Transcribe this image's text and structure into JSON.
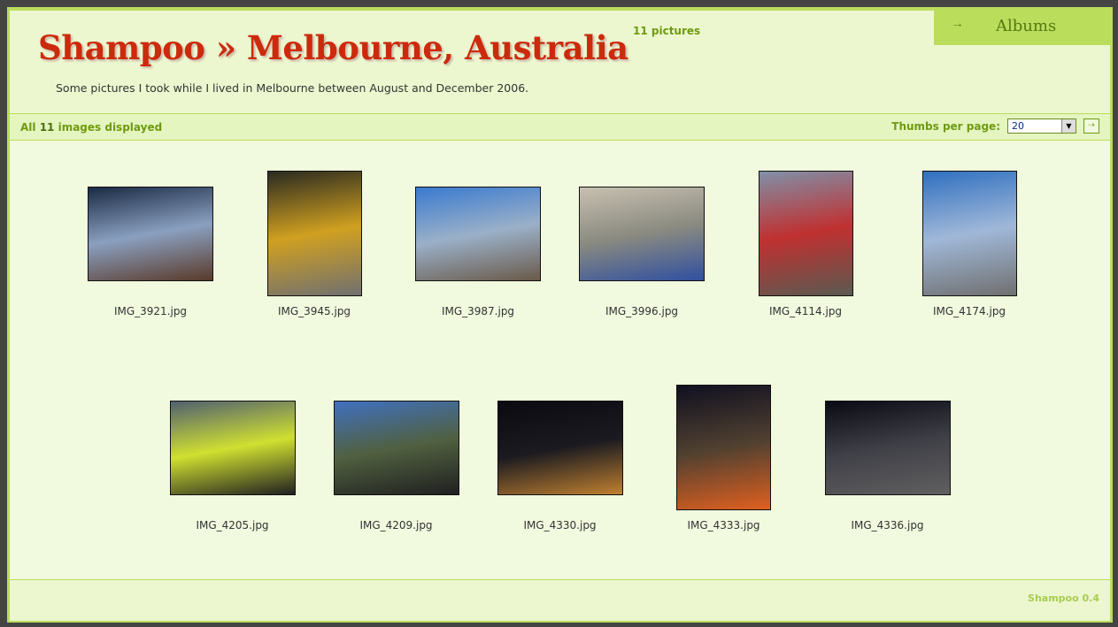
{
  "header": {
    "title": "Shampoo » Melbourne, Australia",
    "picture_count": "11 pictures",
    "description": "Some pictures I took while I lived in Melbourne between August and December 2006.",
    "albums_arrow": "⇢",
    "albums_label": "Albums"
  },
  "toolbar": {
    "all": "All",
    "count": "11",
    "displayed": "images displayed",
    "thumbs_label": "Thumbs per page:",
    "thumbs_value": "20",
    "dropdown_icon": "▼",
    "go_icon": "⇢"
  },
  "images": [
    {
      "name": "IMG_3921.jpg",
      "orientation": "landscape",
      "colors": [
        "#1a2a44",
        "#8aa0c0",
        "#5a3a2a"
      ]
    },
    {
      "name": "IMG_3945.jpg",
      "orientation": "portrait",
      "colors": [
        "#2a2a20",
        "#d0a020",
        "#707070"
      ]
    },
    {
      "name": "IMG_3987.jpg",
      "orientation": "landscape",
      "colors": [
        "#3a7ad0",
        "#9ab0c8",
        "#6a5a4a"
      ]
    },
    {
      "name": "IMG_3996.jpg",
      "orientation": "landscape",
      "colors": [
        "#c8c0b0",
        "#8a8a80",
        "#3050a0"
      ]
    },
    {
      "name": "IMG_4114.jpg",
      "orientation": "portrait",
      "colors": [
        "#8090a8",
        "#c03030",
        "#5a5a50"
      ]
    },
    {
      "name": "IMG_4174.jpg",
      "orientation": "portrait",
      "colors": [
        "#3070c0",
        "#a0b8d8",
        "#707070"
      ]
    },
    {
      "name": "IMG_4205.jpg",
      "orientation": "landscape",
      "colors": [
        "#506070",
        "#d0e030",
        "#202020"
      ]
    },
    {
      "name": "IMG_4209.jpg",
      "orientation": "landscape",
      "colors": [
        "#4070c0",
        "#506040",
        "#202020"
      ]
    },
    {
      "name": "IMG_4330.jpg",
      "orientation": "landscape",
      "colors": [
        "#0a0a10",
        "#1a1a20",
        "#c08030"
      ]
    },
    {
      "name": "IMG_4333.jpg",
      "orientation": "portrait",
      "colors": [
        "#101020",
        "#504030",
        "#e06020"
      ]
    },
    {
      "name": "IMG_4336.jpg",
      "orientation": "landscape",
      "colors": [
        "#0a0a14",
        "#404048",
        "#606060"
      ]
    }
  ],
  "footer": {
    "version": "Shampoo 0.4"
  }
}
